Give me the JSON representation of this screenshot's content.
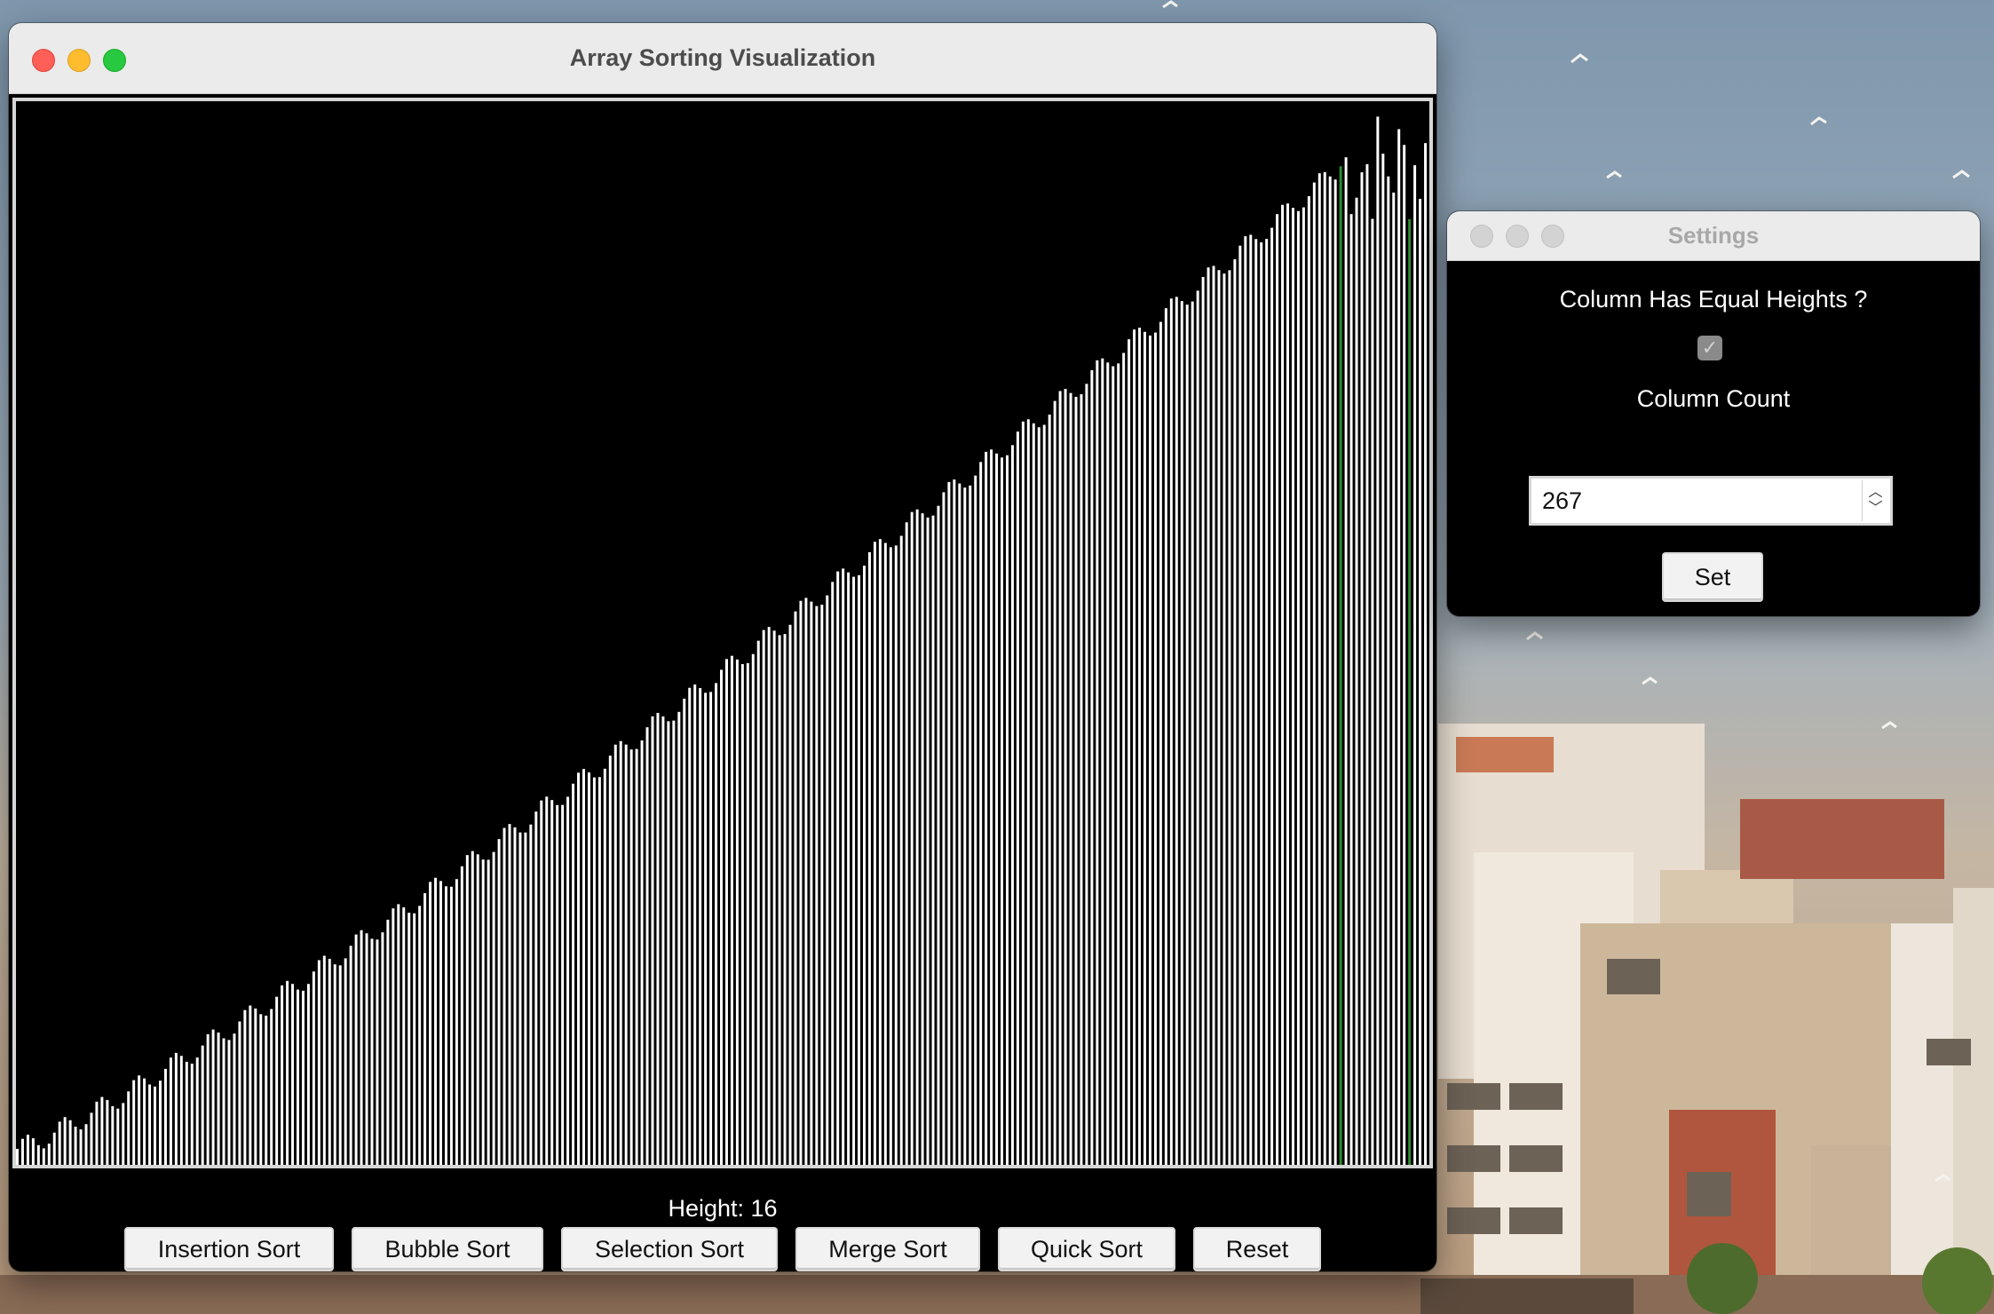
{
  "main_window": {
    "title": "Array Sorting Visualization",
    "height_readout": "Height: 16",
    "buttons": {
      "insertion": "Insertion Sort",
      "bubble": "Bubble Sort",
      "selection": "Selection Sort",
      "merge": "Merge Sort",
      "quick": "Quick Sort",
      "reset": "Reset"
    }
  },
  "settings_window": {
    "title": "Settings",
    "equal_heights_label": "Column Has Equal Heights ?",
    "equal_heights_checked": true,
    "column_count_label": "Column Count",
    "column_count_value": "267",
    "set_label": "Set"
  },
  "visualization": {
    "column_count": 267,
    "bar_color": "#ffffff",
    "highlight_color": "#2e8b2e",
    "highlight_indices": [
      250,
      263
    ],
    "background_color": "#000000"
  },
  "icons": {
    "close": "close-icon",
    "minimize": "minimize-icon",
    "maximize": "maximize-icon",
    "stepper": "stepper-icon",
    "checkbox": "checkmark-icon"
  }
}
